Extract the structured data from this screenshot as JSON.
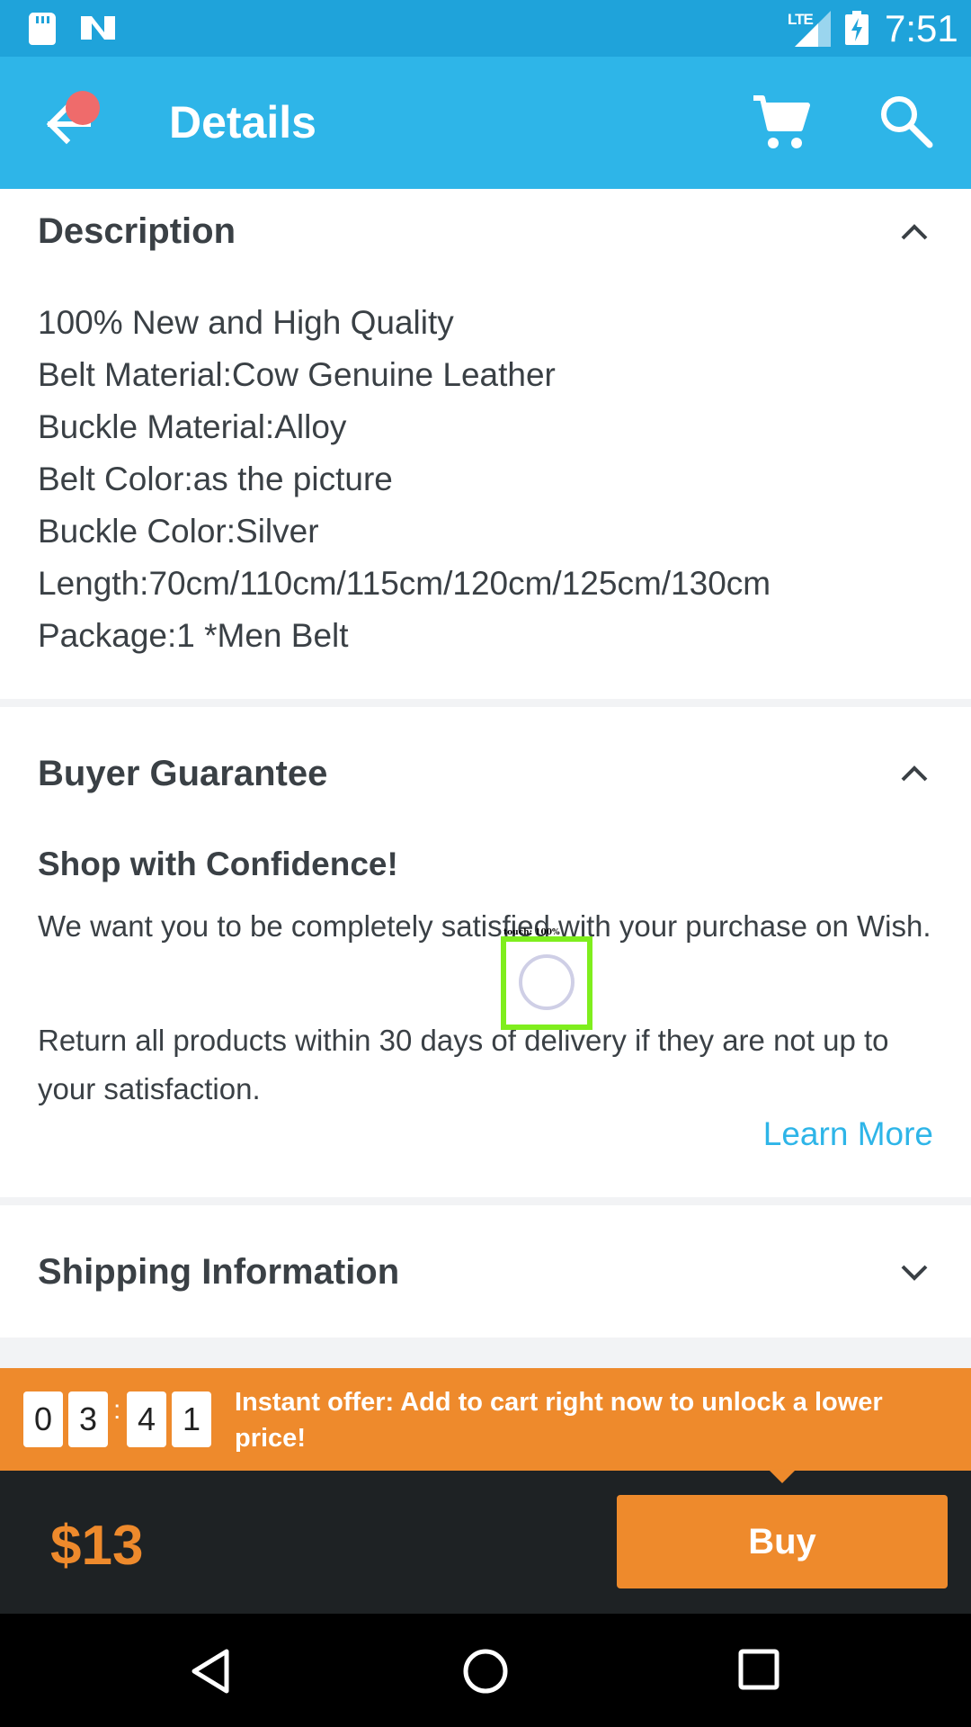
{
  "status_bar": {
    "network": "LTE",
    "time": "7:51"
  },
  "app_bar": {
    "title": "Details"
  },
  "description": {
    "title": "Description",
    "lines": [
      "100% New and High Quality",
      "Belt Material:Cow Genuine Leather",
      "Buckle Material:Alloy",
      "Belt Color:as the picture",
      "Buckle Color:Silver",
      "Length:70cm/110cm/115cm/120cm/125cm/130cm",
      "Package:1 *Men Belt"
    ]
  },
  "buyer_guarantee": {
    "title": "Buyer Guarantee",
    "subtitle": "Shop with Confidence!",
    "paragraph1": "We want you to be completely satisfied with your purchase on Wish.",
    "paragraph2": "Return all products within 30 days of delivery if they are not up to your satisfaction.",
    "learn_more": "Learn More"
  },
  "shipping": {
    "title": "Shipping Information"
  },
  "touch_indicator": {
    "label": "touch: 100%"
  },
  "offer": {
    "timer_digits": [
      "0",
      "3",
      "4",
      "1"
    ],
    "separator": ":",
    "text": "Instant offer: Add to cart right now to unlock a lower price!"
  },
  "purchase": {
    "price": "$13",
    "buy_label": "Buy"
  },
  "colors": {
    "app_bar": "#2eb5e8",
    "status_bar": "#1fa3da",
    "accent": "#ee8a2c",
    "link": "#2eb5e8",
    "dark_bar": "#1e2224"
  }
}
